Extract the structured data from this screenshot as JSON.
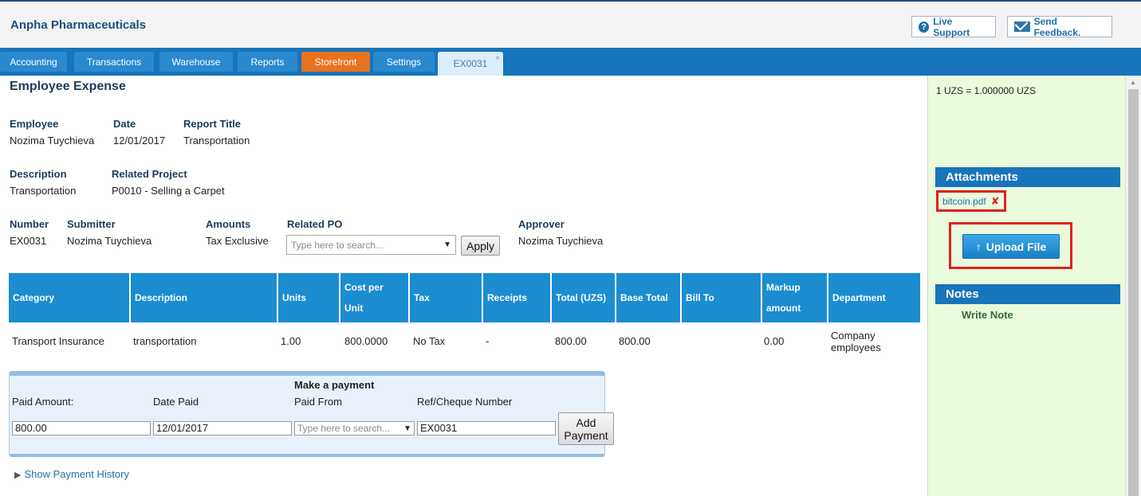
{
  "header": {
    "company": "Anpha Pharmaceuticals",
    "live_support": "Live Support",
    "send_feedback": "Send Feedback."
  },
  "tabs": [
    {
      "label": "Accounting"
    },
    {
      "label": "Transactions"
    },
    {
      "label": "Warehouse"
    },
    {
      "label": "Reports"
    },
    {
      "label": "Storefront"
    },
    {
      "label": "Settings"
    },
    {
      "label": "EX0031",
      "close": "×"
    }
  ],
  "expense": {
    "title": "Employee Expense",
    "employee_label": "Employee",
    "employee": "Nozima Tuychieva",
    "date_label": "Date",
    "date": "12/01/2017",
    "report_title_label": "Report Title",
    "report_title": "Transportation",
    "description_label": "Description",
    "description": "Transportation",
    "related_project_label": "Related Project",
    "related_project": "P0010 - Selling a Carpet",
    "number_label": "Number",
    "number": "EX0031",
    "submitter_label": "Submitter",
    "submitter": "Nozima Tuychieva",
    "amounts_label": "Amounts",
    "amounts": "Tax Exclusive",
    "related_po_label": "Related PO",
    "related_po_placeholder": "Type here to search...",
    "apply_label": "Apply",
    "approver_label": "Approver",
    "approver": "Nozima Tuychieva"
  },
  "table": {
    "headers": [
      "Category",
      "Description",
      "Units",
      "Cost per Unit",
      "Tax",
      "Receipts",
      "Total (UZS)",
      "Base Total",
      "Bill To",
      "Markup amount",
      "Department"
    ],
    "rows": [
      [
        "Transport Insurance",
        "transportation",
        "1.00",
        "800.0000",
        "No Tax",
        "-",
        "800.00",
        "800.00",
        "",
        "0.00",
        "Company employees"
      ]
    ]
  },
  "payment": {
    "title": "Make a payment",
    "paid_amount_label": "Paid Amount:",
    "paid_amount": "800.00",
    "date_paid_label": "Date Paid",
    "date_paid": "12/01/2017",
    "paid_from_label": "Paid From",
    "paid_from_placeholder": "Type here to search...",
    "ref_label": "Ref/Cheque Number",
    "ref": "EX0031",
    "add_label": "Add Payment"
  },
  "history_link": "Show Payment History",
  "sidebar": {
    "rate": "1 UZS = 1.000000 UZS",
    "attachments_title": "Attachments",
    "attachment_file": "bitcoin.pdf",
    "upload_label": "Upload File",
    "notes_title": "Notes",
    "write_note": "Write Note"
  }
}
